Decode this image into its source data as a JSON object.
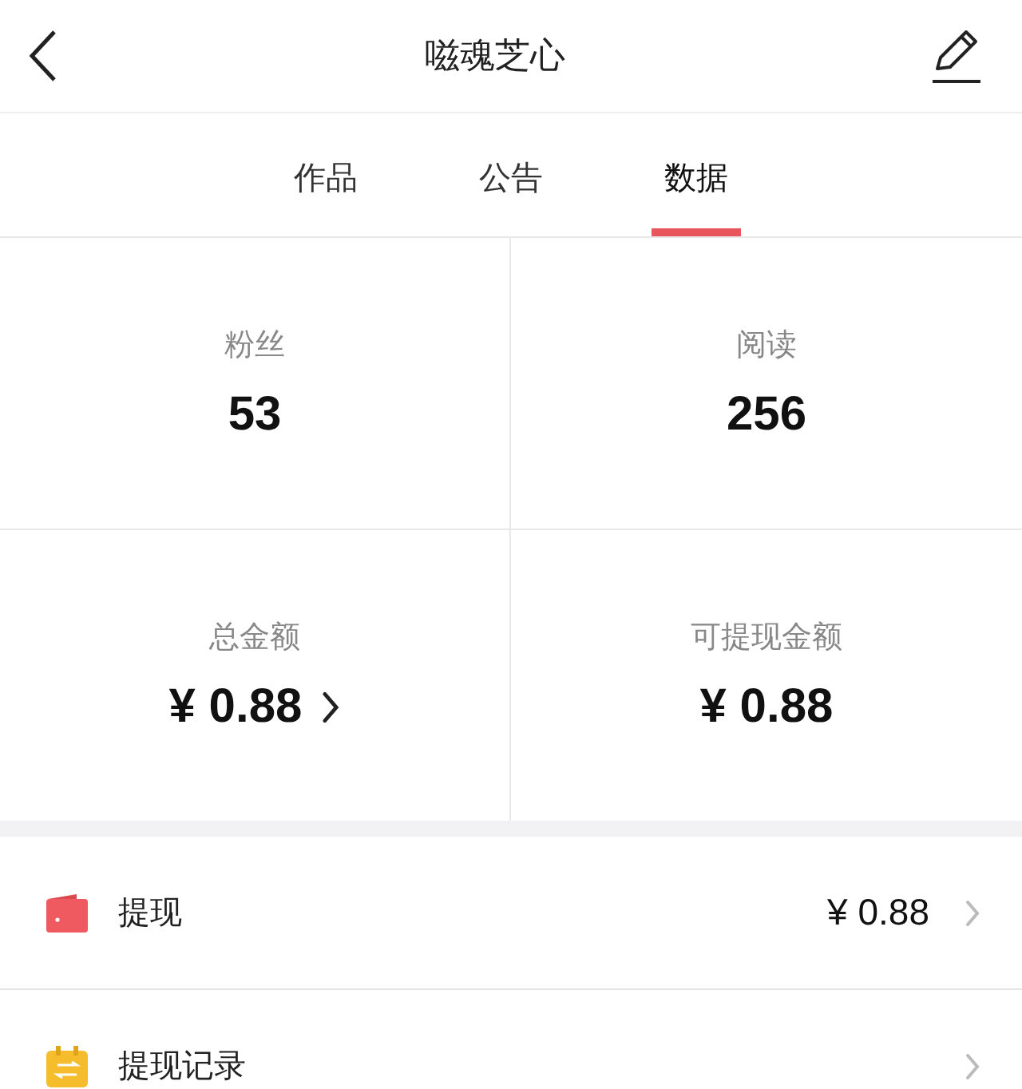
{
  "header": {
    "title": "嗞魂芝心"
  },
  "tabs": [
    {
      "label": "作品",
      "selected": false
    },
    {
      "label": "公告",
      "selected": false
    },
    {
      "label": "数据",
      "selected": true
    }
  ],
  "stats": [
    {
      "label": "粉丝",
      "value": "53",
      "link": false
    },
    {
      "label": "阅读",
      "value": "256",
      "link": false
    },
    {
      "label": "总金额",
      "value": "¥ 0.88",
      "link": true
    },
    {
      "label": "可提现金额",
      "value": "¥ 0.88",
      "link": false
    }
  ],
  "menu": [
    {
      "kind": "wallet",
      "label": "提现",
      "value": "¥ 0.88"
    },
    {
      "kind": "record",
      "label": "提现记录"
    }
  ]
}
